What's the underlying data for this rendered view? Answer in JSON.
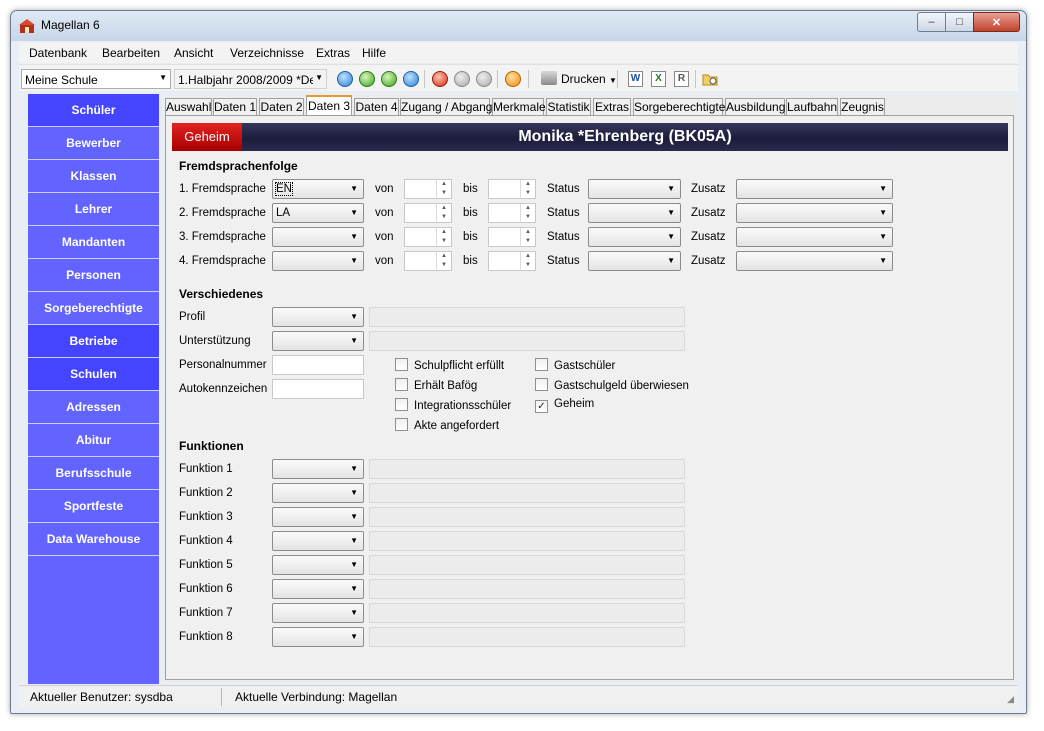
{
  "window": {
    "title": "Magellan 6",
    "controls": {
      "minimize": "–",
      "maximize": "□",
      "close": "✕"
    }
  },
  "menu": [
    "Datenbank",
    "Bearbeiten",
    "Ansicht",
    "Verzeichnisse",
    "Extras",
    "Hilfe"
  ],
  "toolbar": {
    "school": "Meine Schule",
    "period": "1.Halbjahr 2008/2009 *De",
    "print_label": "Drucken",
    "icons": [
      "first-record-icon",
      "previous-record-icon",
      "next-record-icon",
      "last-record-icon",
      "add-record-icon",
      "save-record-icon",
      "cancel-record-icon",
      "refresh-icon"
    ],
    "doc_icons": {
      "word": "W",
      "excel": "X",
      "report": "R"
    }
  },
  "sidebar": {
    "items": [
      "Schüler",
      "Bewerber",
      "Klassen",
      "Lehrer",
      "Mandanten",
      "Personen",
      "Sorgeberechtigte",
      "Betriebe",
      "Schulen",
      "Adressen",
      "Abitur",
      "Berufsschule",
      "Sportfeste",
      "Data Warehouse"
    ],
    "active": [
      "Schüler",
      "Betriebe",
      "Schulen"
    ]
  },
  "tabs": [
    "Auswahl",
    "Daten 1",
    "Daten 2",
    "Daten 3",
    "Daten 4",
    "Zugang / Abgang",
    "Merkmale",
    "Statistik",
    "Extras",
    "Sorgeberechtigte",
    "Ausbildung",
    "Laufbahn",
    "Zeugnis"
  ],
  "active_tab": "Daten 3",
  "header": {
    "badge": "Geheim",
    "name": "Monika *Ehrenberg (BK05A)"
  },
  "languages": {
    "title": "Fremdsprachenfolge",
    "from_label": "von",
    "to_label": "bis",
    "status_label": "Status",
    "extra_label": "Zusatz",
    "rows": [
      {
        "label": "1. Fremdsprache",
        "value": "EN"
      },
      {
        "label": "2. Fremdsprache",
        "value": "LA"
      },
      {
        "label": "3. Fremdsprache",
        "value": ""
      },
      {
        "label": "4. Fremdsprache",
        "value": ""
      }
    ]
  },
  "misc": {
    "title": "Verschiedenes",
    "profile_label": "Profil",
    "support_label": "Unterstützung",
    "personnel_label": "Personalnummer",
    "plate_label": "Autokennzeichen",
    "checkboxes_left": [
      {
        "label": "Schulpflicht erfüllt",
        "checked": false
      },
      {
        "label": "Erhält Bafög",
        "checked": false
      },
      {
        "label": "Integrationsschüler",
        "checked": false
      },
      {
        "label": "Akte angefordert",
        "checked": false
      }
    ],
    "checkboxes_right": [
      {
        "label": "Gastschüler",
        "checked": false
      },
      {
        "label": "Gastschulgeld überwiesen",
        "checked": false
      },
      {
        "label": "Geheim",
        "checked": true
      }
    ],
    "check_mark": "✓"
  },
  "functions": {
    "title": "Funktionen",
    "items": [
      "Funktion 1",
      "Funktion 2",
      "Funktion 3",
      "Funktion 4",
      "Funktion 5",
      "Funktion 6",
      "Funktion 7",
      "Funktion 8"
    ]
  },
  "status": {
    "user": "Aktueller Benutzer: sysdba",
    "connection": "Aktuelle Verbindung: Magellan"
  },
  "colors": {
    "sidebar": "#6363ff",
    "sidebar_active": "#4545ff",
    "badge": "#cc0000",
    "header": "#1c1c3c"
  }
}
